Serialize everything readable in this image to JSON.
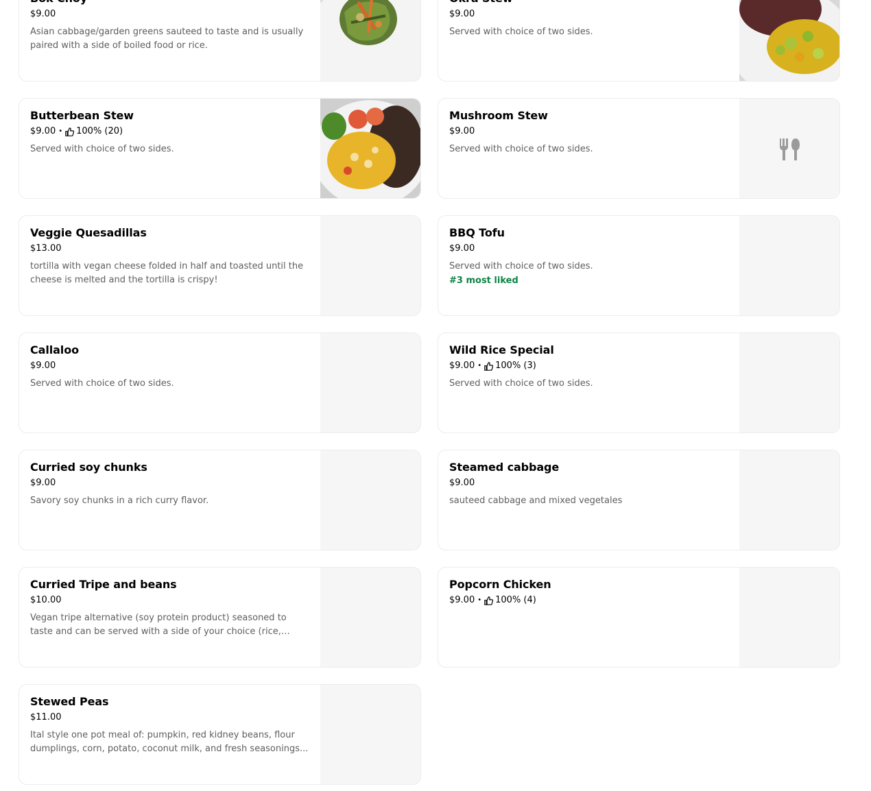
{
  "menu": {
    "items": [
      {
        "name": "Bok Choy",
        "price": "$9.00",
        "rating": "",
        "description": "Asian cabbage/garden greens sauteed to taste and is usually paired with a side of boiled food or rice.",
        "badge": "",
        "image": "photo-greens-plate"
      },
      {
        "name": "Okra Stew",
        "price": "$9.00",
        "rating": "",
        "description": "Served with choice of two sides.",
        "badge": "",
        "image": "photo-okra-rice-plate"
      },
      {
        "name": "Butterbean Stew",
        "price": "$9.00",
        "rating": "100% (20)",
        "description": "Served with choice of two sides.",
        "badge": "",
        "image": "photo-butterbean-plate"
      },
      {
        "name": "Mushroom Stew",
        "price": "$9.00",
        "rating": "",
        "description": "Served with choice of two sides.",
        "badge": "",
        "image": "fork-knife-icon"
      },
      {
        "name": "Veggie Quesadillas",
        "price": "$13.00",
        "rating": "",
        "description": "tortilla with vegan cheese folded in half and toasted until the cheese is melted and the tortilla is crispy!",
        "badge": "",
        "image": "blank"
      },
      {
        "name": "BBQ Tofu",
        "price": "$9.00",
        "rating": "",
        "description": "Served with choice of two sides.",
        "badge": "#3 most liked",
        "image": "blank"
      },
      {
        "name": "Callaloo",
        "price": "$9.00",
        "rating": "",
        "description": "Served with choice of two sides.",
        "badge": "",
        "image": "blank"
      },
      {
        "name": "Wild Rice Special",
        "price": "$9.00",
        "rating": "100% (3)",
        "description": "Served with choice of two sides.",
        "badge": "",
        "image": "blank"
      },
      {
        "name": "Curried soy chunks",
        "price": "$9.00",
        "rating": "",
        "description": "Savory soy chunks in a rich curry flavor.",
        "badge": "",
        "image": "blank"
      },
      {
        "name": "Steamed cabbage",
        "price": "$9.00",
        "rating": "",
        "description": "sauteed cabbage and mixed vegetales",
        "badge": "",
        "image": "blank"
      },
      {
        "name": "Curried Tripe and beans",
        "price": "$10.00",
        "rating": "",
        "description": "Vegan tripe alternative (soy protein product) seasoned to taste and can be served with a side of your choice (rice, veggies, or...",
        "badge": "",
        "image": "blank"
      },
      {
        "name": "Popcorn Chicken",
        "price": "$9.00",
        "rating": "100% (4)",
        "description": "",
        "badge": "",
        "image": "blank"
      },
      {
        "name": "Stewed Peas",
        "price": "$11.00",
        "rating": "",
        "description": "Ital style one pot meal of: pumpkin, red kidney beans, flour dumplings, corn, potato, coconut milk, and fresh seasonings...",
        "badge": "",
        "image": "blank"
      }
    ]
  },
  "colors": {
    "badge": "#0e8345",
    "description": "#5e5e5e",
    "placeholder_bg": "#f6f6f6",
    "border": "#ececec"
  }
}
